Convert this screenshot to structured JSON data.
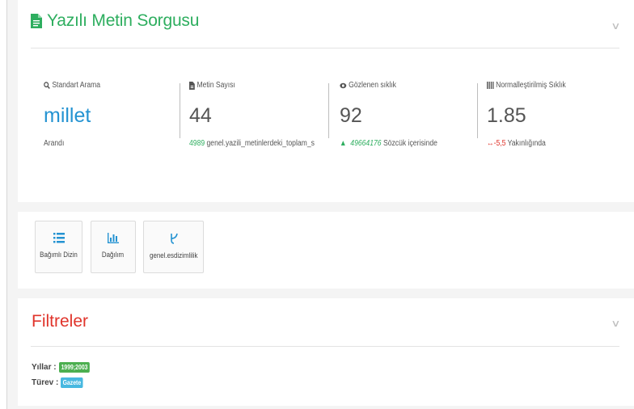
{
  "query_panel": {
    "title": "Yazılı Metin Sorgusu",
    "collapse_icon": "chevron-down-icon"
  },
  "stats": [
    {
      "label": "Standart Arama",
      "icon": "search-icon",
      "value": "millet",
      "foot": "Arandı"
    },
    {
      "label": "Metin Sayısı",
      "icon": "file-icon",
      "value": "44",
      "foot_num": "4989",
      "foot_text": " genel.yazili_metinlerdeki_toplam_s"
    },
    {
      "label": "Gözlenen sıklık",
      "icon": "eye-icon",
      "value": "92",
      "foot_num": "49664176",
      "foot_text": " Sözcük içerisinde"
    },
    {
      "label": "Normalleştirilmiş Sıklık",
      "icon": "bars-icon",
      "value": "1.85",
      "foot_num": "-5,5",
      "foot_text": " Yakınlığında"
    }
  ],
  "tools": [
    {
      "label": "Bağımlı Dizin",
      "icon": "list-icon"
    },
    {
      "label": "Dağılım",
      "icon": "bar-chart-icon"
    },
    {
      "label": "genel.esdizimlilik",
      "icon": "fork-icon"
    }
  ],
  "filters": {
    "title": "Filtreler",
    "years_label": "Yıllar :",
    "years_value": "1999;2003",
    "type_label": "Türev :",
    "type_value": "Gazete"
  },
  "colors": {
    "green": "#2eae5f",
    "blue": "#2493d2",
    "red": "#e0342b",
    "badge_blue": "#47b8e0"
  }
}
